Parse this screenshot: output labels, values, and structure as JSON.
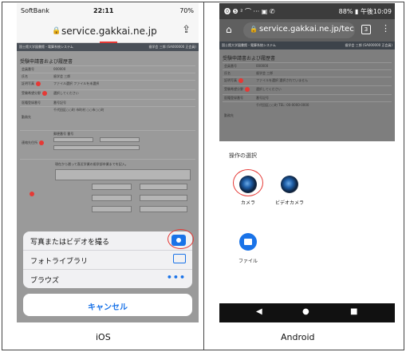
{
  "ios": {
    "status": {
      "carrier": "SoftBank",
      "time": "22:11",
      "battery": "70%"
    },
    "url": {
      "host": "service.gakkai.ne.jp",
      "share_icon": "share-icon"
    },
    "web": {
      "system_name": "国士館大学図書館・電算系統システム",
      "user_name": "歯学会 三郎 (SA000000 正会員)",
      "page_title": "受験申請書および履歴書",
      "rows": [
        {
          "label": "会員番号",
          "value": "000000"
        },
        {
          "label": "氏名",
          "value": "歯学会 三郎"
        },
        {
          "label": "証明写真",
          "value": "ファイル選択 ファイルを未選択"
        },
        {
          "label": "受験希望分野",
          "value": "選択してください"
        },
        {
          "label": "医籍登録番号",
          "value": "番号記号"
        },
        {
          "label": "勤務先",
          "value": "千代田区○○町 市町村 ○○市○○町"
        },
        {
          "label": "連絡先住所",
          "value": "郵便番号 番号"
        }
      ],
      "career_note": "現在から遡って直近学業の歯学部卒業までを記入。"
    },
    "sheet": {
      "items": [
        {
          "label": "写真またはビデオを撮る",
          "icon": "camera-icon"
        },
        {
          "label": "フォトライブラリ",
          "icon": "photo-library-icon"
        },
        {
          "label": "ブラウズ",
          "icon": "more-icon"
        }
      ],
      "cancel": "キャンセル"
    }
  },
  "android": {
    "status": {
      "left": "⓿ ❺ ² ⌒ ··· ▣ ✆",
      "battery": "88%",
      "time": "午後10:09"
    },
    "url": {
      "host": "service.gakkai.ne.jp/tec",
      "tab_count": "3"
    },
    "web": {
      "system_name": "国士館大学図書館・電算系統システム",
      "user_name": "歯学会 三郎 (SA000000 正会員)",
      "page_title": "受験申請書および履歴書",
      "rows": [
        {
          "label": "会員番号",
          "value": "000000"
        },
        {
          "label": "氏名",
          "value": "歯学会 三郎"
        },
        {
          "label": "証明写真",
          "value": "ファイルを選択 選択されていません"
        },
        {
          "label": "受験希望分野",
          "value": "選択してください"
        },
        {
          "label": "医籍登録番号",
          "value": "番号記号"
        },
        {
          "label": "勤務先",
          "value": "千代田区○○町 TEL: 00-0000-0000"
        }
      ]
    },
    "chooser": {
      "title": "操作の選択",
      "apps": [
        {
          "label": "カメラ",
          "icon": "camera-app-icon"
        },
        {
          "label": "ビデオカメラ",
          "icon": "video-camera-app-icon"
        },
        {
          "label": "ファイル",
          "icon": "folder-icon"
        }
      ]
    }
  },
  "captions": {
    "left": "iOS",
    "right": "Android"
  }
}
